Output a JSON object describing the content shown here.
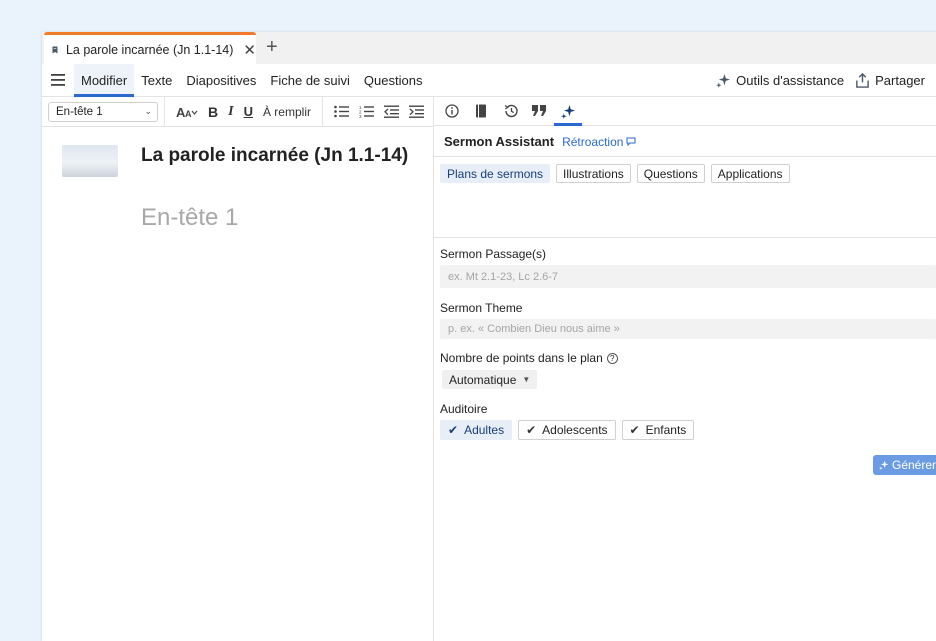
{
  "tab": {
    "title": "La parole incarnée (Jn 1.1-14)",
    "close": "✕",
    "new": "+"
  },
  "menu": {
    "items": [
      "Modifier",
      "Texte",
      "Diapositives",
      "Fiche de suivi",
      "Questions"
    ],
    "assist": "Outils d'assistance",
    "share": "Partager"
  },
  "format": {
    "style": "En-tête 1",
    "bold": "B",
    "italic": "I",
    "underline": "U",
    "fill": "À remplir"
  },
  "editor": {
    "title": "La parole incarnée (Jn 1.1-14)",
    "placeholder": "En-tête 1"
  },
  "panel": {
    "title": "Sermon Assistant",
    "feedback": "Rétroaction",
    "modes": [
      "Plans de sermons",
      "Illustrations",
      "Questions",
      "Applications"
    ],
    "passage_label": "Sermon Passage(s)",
    "passage_placeholder": "ex. Mt 2.1-23, Lc 2.6-7",
    "theme_label": "Sermon Theme",
    "theme_placeholder": "p. ex. « Combien Dieu nous aime »",
    "points_label": "Nombre de points dans le plan",
    "points_value": "Automatique",
    "audience_label": "Auditoire",
    "audiences": [
      "Adultes",
      "Adolescents",
      "Enfants"
    ],
    "generate": "Générer"
  },
  "colors": {
    "accent": "#2a6ad0",
    "tab_accent": "#f07b2b",
    "generate": "#6b9be3"
  }
}
